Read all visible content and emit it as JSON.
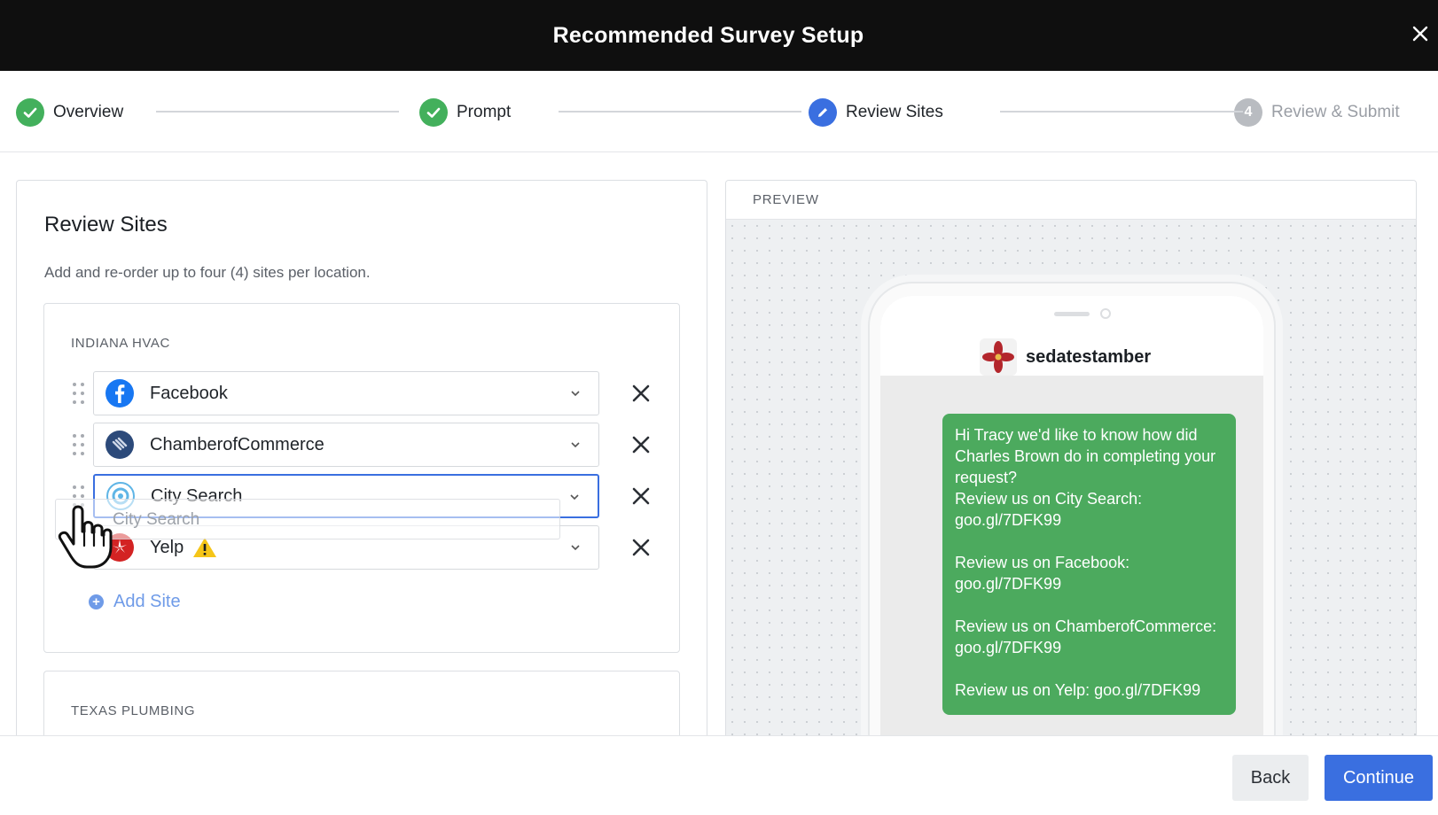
{
  "header": {
    "title": "Recommended Survey Setup",
    "close_icon": "close-icon"
  },
  "stepper": {
    "steps": [
      {
        "label": "Overview",
        "state": "done",
        "icon": "check-icon"
      },
      {
        "label": "Prompt",
        "state": "done",
        "icon": "check-icon"
      },
      {
        "label": "Review Sites",
        "state": "active",
        "icon": "pencil-icon"
      },
      {
        "label": "Review & Submit",
        "state": "todo",
        "number": "4"
      }
    ]
  },
  "review_sites": {
    "title": "Review Sites",
    "description": "Add and re-order up to four (4) sites per location.",
    "locations": [
      {
        "name": "INDIANA HVAC",
        "sites": [
          {
            "name": "Facebook",
            "icon": "facebook-icon"
          },
          {
            "name": "ChamberofCommerce",
            "icon": "chamber-of-commerce-icon"
          },
          {
            "name": "City Search",
            "icon": "citysearch-icon"
          },
          {
            "name": "Yelp",
            "icon": "yelp-icon",
            "warning": true
          }
        ],
        "add_site_label": "Add Site"
      },
      {
        "name": "TEXAS PLUMBING"
      }
    ],
    "drag_ghost_label": "City Search"
  },
  "preview": {
    "label": "PREVIEW",
    "sender": "sedatestamber",
    "message_lines": [
      "Hi Tracy we'd like to know how did Charles Brown do in completing your request?",
      "Review us on City Search:",
      "goo.gl/7DFK99",
      "Review us on Facebook:",
      "goo.gl/7DFK99",
      "Review us on ChamberofCommerce:",
      "goo.gl/7DFK99",
      "Review us on Yelp: goo.gl/7DFK99"
    ]
  },
  "footer": {
    "back_label": "Back",
    "continue_label": "Continue"
  },
  "colors": {
    "success": "#43b05c",
    "primary": "#3a6fe0",
    "bubble": "#4caa5e",
    "topbar": "#0f0f0f"
  }
}
